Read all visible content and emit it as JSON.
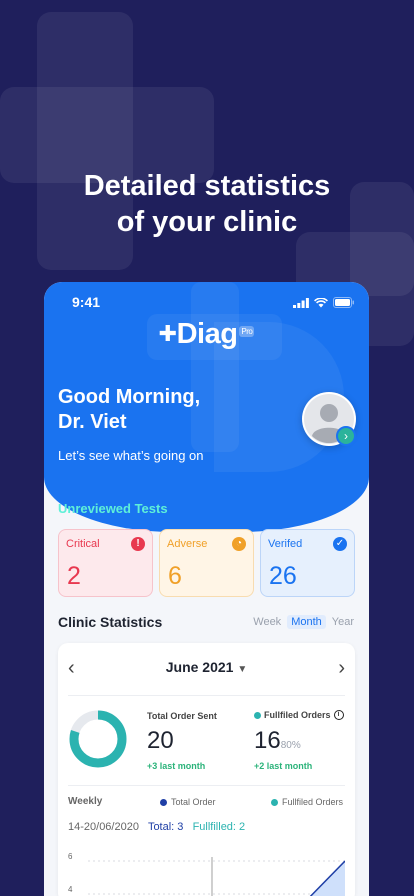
{
  "promo": {
    "line1": "Detailed statistics",
    "line2": "of your clinic"
  },
  "status_bar": {
    "time": "9:41"
  },
  "app": {
    "logo": "Diag",
    "logo_badge": "Pro"
  },
  "greeting": {
    "line1": "Good Morning,",
    "line2": "Dr. Viet",
    "subtitle": "Let’s see what’s going on"
  },
  "unreviewed": {
    "title": "Unreviewed Tests",
    "cards": [
      {
        "label": "Critical",
        "value": "2",
        "icon": "alert-icon",
        "color": "#e8384f",
        "bg": "#fde9ec",
        "border": "#f6c3cb"
      },
      {
        "label": "Adverse",
        "value": "6",
        "icon": "gauge-icon",
        "color": "#f0a028",
        "bg": "#fff5e6",
        "border": "#f8dcb0"
      },
      {
        "label": "Verifed",
        "value": "26",
        "icon": "verified-badge-icon",
        "color": "#1a73f0",
        "bg": "#e6f0fd",
        "border": "#bcd5f8"
      }
    ]
  },
  "clinic_stats": {
    "title": "Clinic Statistics",
    "ranges": [
      "Week",
      "Month",
      "Year"
    ],
    "selected_range": "Month",
    "month": "June 2021",
    "total_orders": {
      "label": "Total Order Sent",
      "value": "20",
      "delta": "+3 last month"
    },
    "fulfilled_orders": {
      "label": "Fullfiled Orders",
      "value": "16",
      "percent": "80%",
      "delta": "+2 last month"
    },
    "fulfilled_ratio": 0.8,
    "weekly": {
      "label": "Weekly",
      "legend_total": "Total Order",
      "legend_fulfilled": "Fullfiled Orders",
      "date_range": "14-20/06/2020",
      "total_text": "Total: 3",
      "fulfilled_text": "Fullfilled: 2"
    },
    "chart_ticks": [
      "6",
      "4"
    ]
  },
  "colors": {
    "brand": "#1a73f0",
    "teal": "#2bb3b0",
    "navy": "#1f3fa6",
    "background": "#1f1f5c"
  }
}
